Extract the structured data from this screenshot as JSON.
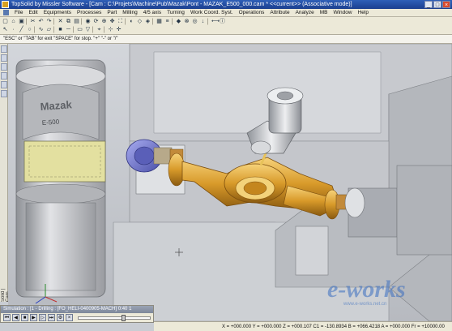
{
  "window": {
    "title": "TopSolid by Missler Software - [Cam : C:\\Projets\\Machine\\Pub\\Mazak\\Pont - MAZAK_E500_000.cam * <<current>> (Associative mode)]",
    "controls": [
      "_",
      "□",
      "×"
    ]
  },
  "menu": [
    "File",
    "Edit",
    "Equipments",
    "Processes",
    "Part",
    "Milling",
    "4/5 axis",
    "Turning",
    "Work Coord. Syst.",
    "Operations",
    "Attribute",
    "Analyze",
    "MB",
    "Window",
    "Help"
  ],
  "toolbar": {
    "row1": [
      "new-icon",
      "open-icon",
      "save-icon",
      "sep",
      "cut-icon",
      "undo-icon",
      "redo-icon",
      "sep",
      "delete-icon",
      "copy-icon",
      "paste-icon",
      "sep",
      "view-icon",
      "rotate-icon",
      "zoom-icon",
      "pan-icon",
      "fit-icon",
      "sep",
      "shade-icon",
      "wire-icon",
      "hidden-icon",
      "sep",
      "grid-icon",
      "layer-icon",
      "sep",
      "part-icon",
      "mill-icon",
      "turn-icon",
      "drill-icon",
      "sep",
      "measure-icon",
      "info-icon"
    ],
    "row2": [
      "select-icon",
      "point-icon",
      "line-icon",
      "circle-icon",
      "sep",
      "curve-icon",
      "surface-icon",
      "sep",
      "color-icon",
      "style-icon",
      "sep",
      "layer-select-icon",
      "filter-icon",
      "sep",
      "snap-icon",
      "sep",
      "coord-icon",
      "cursor-icon"
    ]
  },
  "command_prompt": "\"ESC\" or \"TAB\" for exit \"SPACE\" for stop. \"+\" \"-\" or \"/\"",
  "side_label": "Solid | Cam",
  "machine": {
    "brand": "Mazak",
    "model": "E-500"
  },
  "watermark": {
    "text": "e-works",
    "subtext": "www.e-works.net.cn"
  },
  "simulation": {
    "title": "Simulation : [1 - Drilling : [FO_HELI-0400905-MACH] 0:40 1",
    "buttons": [
      "rewind-icon",
      "step-back-icon",
      "stop-icon",
      "play-icon",
      "step-forward-icon",
      "end-icon",
      "settings-icon",
      "close-icon"
    ],
    "progress": 0.6
  },
  "status": "X = +000.000  Y = +000.000  Z = +000.107  C1 = -130.8934  B = +066.4218  A = +000.000  Fr = +10000.00",
  "colors": {
    "part": "#d89a2a",
    "fixture": "#6f74c8",
    "machine": "#bfc1c6",
    "titlebar": "#2f5fb8"
  }
}
